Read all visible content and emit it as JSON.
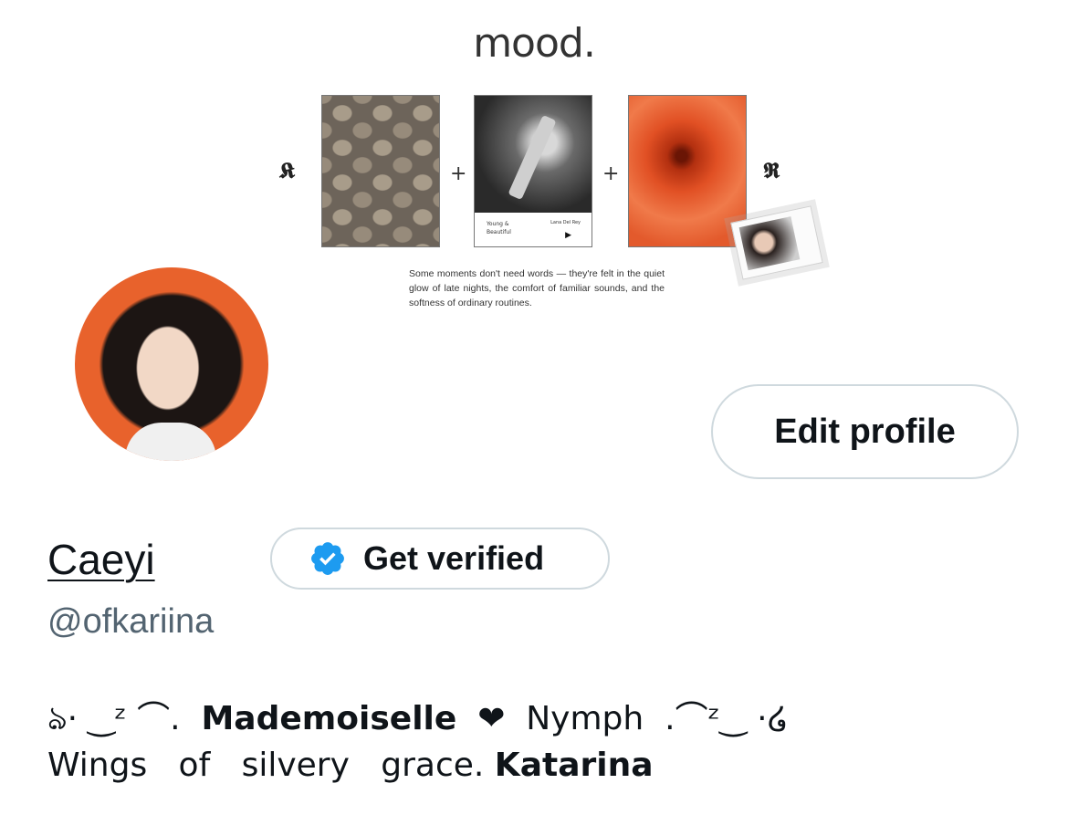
{
  "banner": {
    "title": "mood.",
    "letter_left": "𝕶",
    "letter_right": "𝕽",
    "plus": "+",
    "music_card": {
      "song": "Young & Beautiful",
      "artist": "Lana Del Rey",
      "play_symbol": "▶"
    },
    "caption": "Some moments don't need words — they're felt in the quiet glow of late nights, the comfort of familiar sounds, and the softness of ordinary routines."
  },
  "profile": {
    "edit_button": "Edit profile",
    "display_name": "Caeyi",
    "verify_button": "Get verified",
    "verified_badge_color": "#1d9bf0",
    "handle": "@ofkariina",
    "bio_line1": {
      "deco_left": "ঌ· ‿ᶻ ⌒.",
      "bold": "Mademoiselle",
      "heart": "❤",
      "word": "Nymph",
      "deco_right": ".⌒ᶻ‿ ·໒"
    },
    "bio_line2": {
      "text": "Wings   of   silvery   grace.",
      "bold": "Katarina"
    }
  }
}
